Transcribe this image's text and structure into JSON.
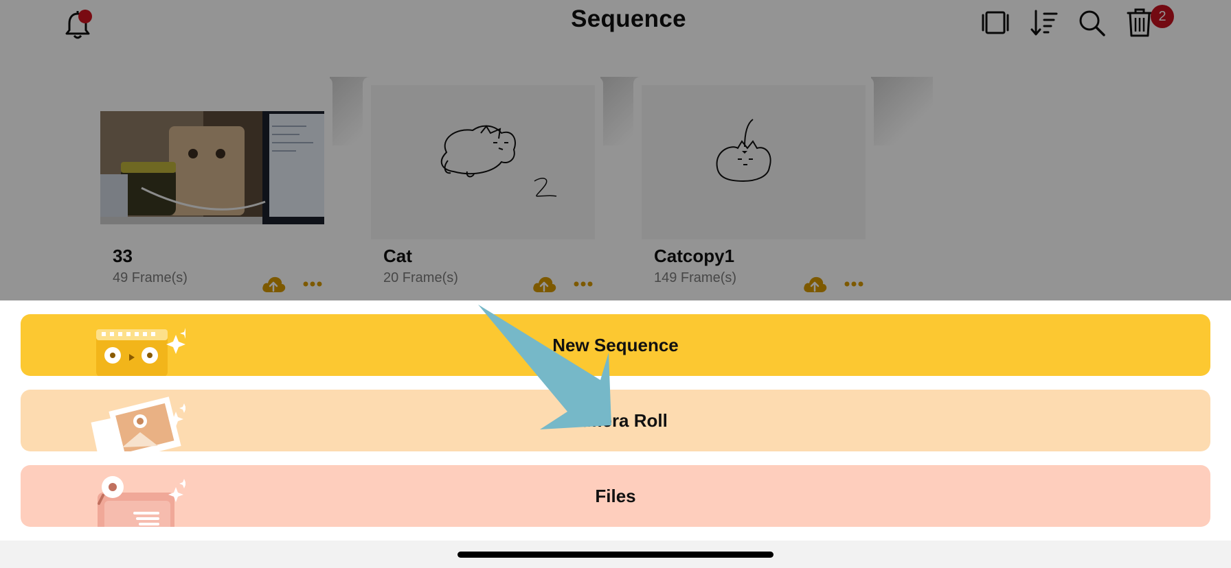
{
  "header": {
    "title": "Sequence",
    "trash_badge": "2"
  },
  "cards": [
    {
      "name": "33",
      "frames": "49 Frame(s)"
    },
    {
      "name": "Cat",
      "frames": "20 Frame(s)"
    },
    {
      "name": "Catcopy1",
      "frames": "149 Frame(s)"
    }
  ],
  "sheet": {
    "options": [
      {
        "label": "New Sequence",
        "color": "#fcc831"
      },
      {
        "label": "Camera Roll",
        "color": "#fddbb0"
      },
      {
        "label": "Files",
        "color": "#fecebd"
      }
    ]
  },
  "colors": {
    "accent": "#d79a00",
    "badge": "#c7121f",
    "arrow": "#76b8c8"
  },
  "icons": [
    "bell-icon",
    "notification-dot",
    "frame-view-icon",
    "sort-icon",
    "search-icon",
    "trash-icon",
    "cloud-upload-icon",
    "more-icon"
  ],
  "card2_sketch_number": "2"
}
